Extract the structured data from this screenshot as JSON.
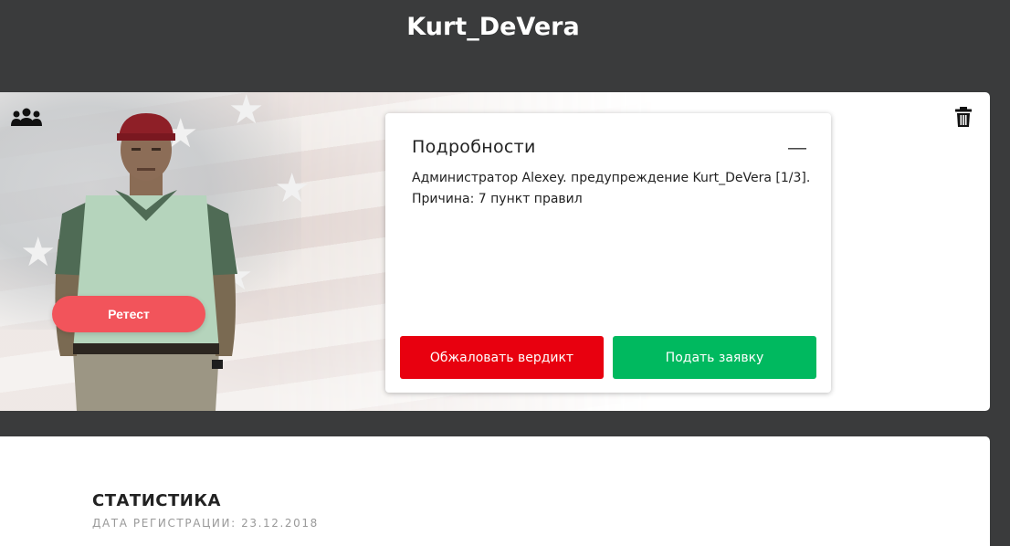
{
  "header": {
    "username": "Kurt_DeVera"
  },
  "profile": {
    "retest_label": "Ретест",
    "group_icon": "users-group-icon",
    "delete_icon": "trash-icon"
  },
  "details": {
    "title": "Подробности",
    "collapse_symbol": "—",
    "text": "Администратор Alexey. предупреждение Kurt_DeVera [1/3]. Причина: 7 пункт правил",
    "appeal_label": "Обжаловать вердикт",
    "submit_label": "Подать заявку"
  },
  "stats": {
    "title": "СТАТИСТИКА",
    "registration": "ДАТА РЕГИСТРАЦИИ: 23.12.2018"
  },
  "colors": {
    "background": "#3a3b3c",
    "retest": "#f2545b",
    "appeal": "#e8000f",
    "submit": "#00b95f"
  }
}
